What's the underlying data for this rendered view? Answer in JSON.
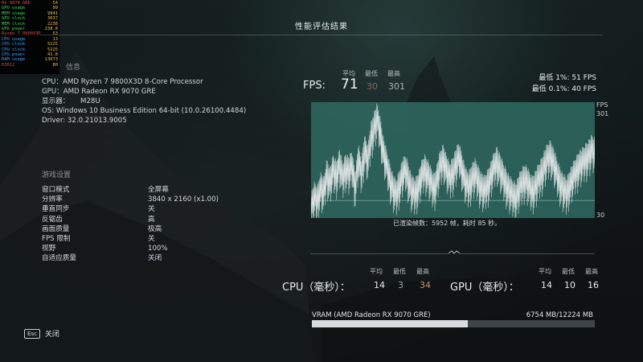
{
  "overlay": {
    "rows": [
      {
        "k": "RX 9070 GRE",
        "v": "54",
        "kind": "hdr"
      },
      {
        "k": "GPU usage",
        "v": "99",
        "kind": "gpu"
      },
      {
        "k": "MEM usage",
        "v": "9841",
        "kind": "gpu"
      },
      {
        "k": "GPU clock",
        "v": "3037",
        "kind": "gpu"
      },
      {
        "k": "MEM clock",
        "v": "2238",
        "kind": "gpu"
      },
      {
        "k": "GPU power",
        "v": "238.8",
        "kind": "gpu"
      },
      {
        "k": "Ryzen 7 9800X3D",
        "v": "53",
        "kind": "hdr"
      },
      {
        "k": "CPU usage",
        "v": "13",
        "kind": "cpu"
      },
      {
        "k": "CPU clock",
        "v": "5225",
        "kind": "cpu"
      },
      {
        "k": "CPU clock",
        "v": "5225",
        "kind": "cpu"
      },
      {
        "k": "CPU power",
        "v": "41.8",
        "kind": "cpu"
      },
      {
        "k": "RAM usage",
        "v": "13673",
        "kind": "cpu"
      },
      {
        "k": "D3D12",
        "v": "80",
        "kind": "hdr"
      }
    ]
  },
  "title": "性能评估结果",
  "system": {
    "section": "信息",
    "cpu": "CPU：AMD Ryzen 7 9800X3D 8-Core Processor",
    "gpu": "GPU：AMD Radeon RX 9070 GRE",
    "display": "显示器：     M28U",
    "os": "OS: Windows 10 Business Edition 64-bit (10.0.26100.4484)",
    "driver": "Driver: 32.0.21013.9005"
  },
  "settings": {
    "section": "游戏设置",
    "rows": [
      {
        "k": "窗口模式",
        "v": "全屏幕"
      },
      {
        "k": "分辨率",
        "v": "3840 x 2160 (x1.00)"
      },
      {
        "k": "垂直同步",
        "v": "关"
      },
      {
        "k": "反锯齿",
        "v": "高"
      },
      {
        "k": "画面质量",
        "v": "极高"
      },
      {
        "k": "FPS 限制",
        "v": "关"
      },
      {
        "k": "视野",
        "v": "100%"
      },
      {
        "k": "自适应质量",
        "v": "关闭"
      }
    ]
  },
  "esc": {
    "key": "Esc",
    "label": "关闭"
  },
  "fps": {
    "label": "FPS:",
    "col_avg": "平均",
    "col_min": "最低",
    "col_max": "最高",
    "avg": "71",
    "min": "30",
    "max": "301",
    "low1": "最低 1%:  51 FPS",
    "low01": "最低 0.1%:  40 FPS",
    "axis_unit": "FPS",
    "axis_top": "301",
    "axis_bottom": "30",
    "frames_text": "已渲染帧数：5952 帧，耗时 85 秒。"
  },
  "cpu_stats": {
    "title": "CPU（毫秒）：",
    "col_avg": "平均",
    "col_min": "最低",
    "col_max": "最高",
    "avg": "14",
    "min": "3",
    "max": "34"
  },
  "gpu_stats": {
    "title": "GPU（毫秒）：",
    "col_avg": "平均",
    "col_min": "最低",
    "col_max": "最高",
    "avg": "14",
    "min": "10",
    "max": "16"
  },
  "vram": {
    "label": "VRAM (AMD Radeon RX 9070 GRE)",
    "value": "6754 MB/12224 MB",
    "used_fraction": 0.5525
  },
  "colors": {
    "chart_bg": "#2f6b63",
    "chart_line": "#d9e0df"
  },
  "chart_data": {
    "type": "line",
    "ylabel": "FPS",
    "ylim": [
      30,
      301
    ],
    "y_samples": [
      70,
      95,
      88,
      120,
      105,
      150,
      130,
      160,
      145,
      175,
      140,
      165,
      155,
      170,
      120,
      185,
      150,
      210,
      180,
      235,
      260,
      280,
      245,
      200,
      170,
      140,
      115,
      100,
      125,
      150,
      160,
      135,
      110,
      105,
      120,
      145,
      160,
      150,
      130,
      115,
      140,
      170,
      185,
      160,
      140,
      155,
      175,
      190,
      160,
      130,
      120,
      140,
      150,
      135,
      120,
      110,
      125,
      145,
      165,
      180,
      160,
      140,
      125,
      110,
      100,
      95,
      115,
      130,
      140,
      125,
      110,
      120,
      135,
      150,
      170,
      185,
      195,
      175,
      150,
      130,
      115,
      105,
      125,
      140,
      155,
      170,
      175,
      185,
      195,
      205,
      200
    ]
  }
}
